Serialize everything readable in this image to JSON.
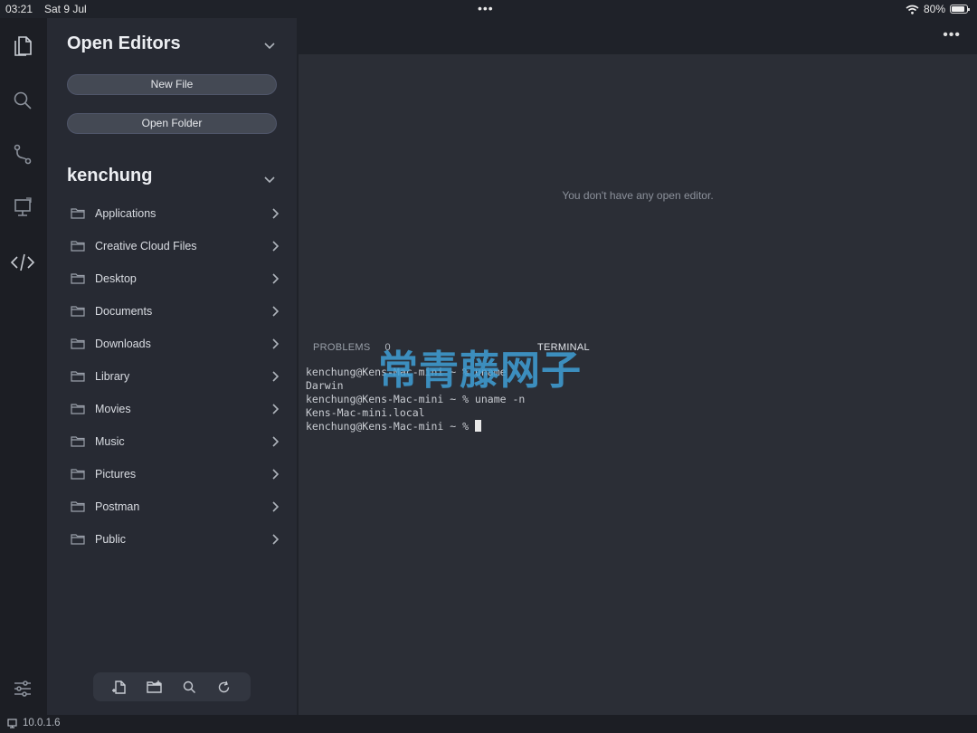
{
  "statusbar": {
    "time": "03:21",
    "date": "Sat 9 Jul",
    "battery": "80%",
    "battery_level": 0.8
  },
  "activity_bar": {
    "icons": [
      "explorer-icon",
      "search-icon",
      "source-control-icon",
      "remote-icon",
      "code-icon",
      "settings-icon"
    ]
  },
  "sidebar": {
    "open_editors_title": "Open Editors",
    "new_file_label": "New File",
    "open_folder_label": "Open Folder",
    "workspace_title": "kenchung",
    "folders": [
      {
        "label": "Applications"
      },
      {
        "label": "Creative Cloud Files"
      },
      {
        "label": "Desktop"
      },
      {
        "label": "Documents"
      },
      {
        "label": "Downloads"
      },
      {
        "label": "Library"
      },
      {
        "label": "Movies"
      },
      {
        "label": "Music"
      },
      {
        "label": "Pictures"
      },
      {
        "label": "Postman"
      },
      {
        "label": "Public"
      }
    ]
  },
  "editor": {
    "empty_message": "You don't have any open editor.",
    "panel_tabs": {
      "problems": "PROBLEMS",
      "problems_count": "0",
      "terminal": "TERMINAL"
    },
    "terminal_lines": [
      "kenchung@Kens-Mac-mini ~ % uname",
      "Darwin",
      "kenchung@Kens-Mac-mini ~ % uname -n",
      "Kens-Mac-mini.local",
      "kenchung@Kens-Mac-mini ~ % "
    ]
  },
  "watermark": "常青藤网子",
  "bottombar": {
    "host": "10.0.1.6"
  }
}
